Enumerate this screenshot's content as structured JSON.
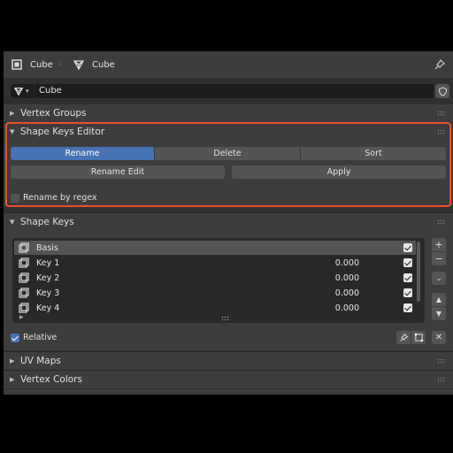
{
  "header": {
    "object_name": "Cube",
    "mesh_name": "Cube"
  },
  "mesh": {
    "name": "Cube"
  },
  "panels": {
    "vertex_groups": "Vertex Groups",
    "shape_keys_editor": "Shape Keys Editor",
    "shape_keys": "Shape Keys",
    "uv_maps": "UV Maps",
    "vertex_colors": "Vertex Colors"
  },
  "editor": {
    "rename": "Rename",
    "delete": "Delete",
    "sort": "Sort",
    "rename_edit": "Rename Edit",
    "apply": "Apply",
    "rename_by_regex": "Rename by regex"
  },
  "shape_keys": [
    {
      "name": "Basis",
      "value": "",
      "enabled": true
    },
    {
      "name": "Key 1",
      "value": "0.000",
      "enabled": true
    },
    {
      "name": "Key 2",
      "value": "0.000",
      "enabled": true
    },
    {
      "name": "Key 3",
      "value": "0.000",
      "enabled": true
    },
    {
      "name": "Key 4",
      "value": "0.000",
      "enabled": true
    }
  ],
  "relative": {
    "label": "Relative",
    "checked": true
  },
  "colors": {
    "accent": "#4772b3",
    "highlight": "#e8522a"
  }
}
